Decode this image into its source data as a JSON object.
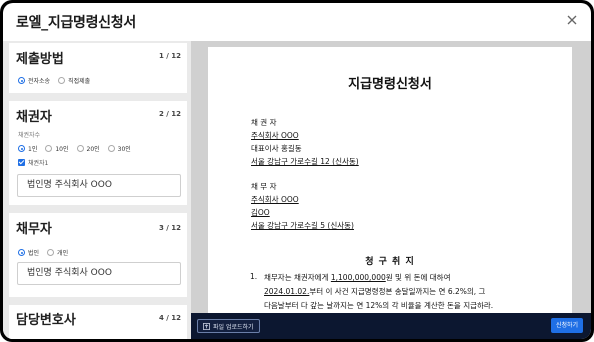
{
  "modal": {
    "title": "로엘_지급명령신청서"
  },
  "sidebar": {
    "card1": {
      "title": "제출방법",
      "step": "1 / 12",
      "options": [
        "전자소송",
        "직접제출"
      ],
      "selected": "전자소송"
    },
    "card2": {
      "title": "채권자",
      "step": "2 / 12",
      "count_caption": "채권자수",
      "count_options": [
        "1인",
        "10인",
        "20인",
        "30인"
      ],
      "count_selected": "1인",
      "checkbox_label": "채권자1",
      "input_value": "법인명 주식회사 OOO"
    },
    "card3": {
      "title": "채무자",
      "step": "3 / 12",
      "options": [
        "법인",
        "개인"
      ],
      "selected": "법인",
      "input_value": "법인명 주식회사 OOO"
    },
    "card4": {
      "title": "담당변호사",
      "step": "4 / 12"
    }
  },
  "document": {
    "title": "지급명령신청서",
    "creditor": {
      "label": "채 권 자",
      "company": "주식회사 OOO",
      "rep": "대표이사 홍길동",
      "address": "서울 강남구 가로수길 12 (신사동)"
    },
    "debtor": {
      "label": "채 무 자",
      "company": "주식회사 OOO",
      "rep": "김OO",
      "address": "서울 강남구 가로수길 5 (신사동)"
    },
    "section_title": "청 구 취 지",
    "claim_number": "1.",
    "claim": {
      "l1_a": "채무자는 채권자에게 ",
      "l1_amount": "1,100,000,000",
      "l1_b": "원 및 위 돈에 대하여",
      "l2_date": "2024.01.02.",
      "l2_b": "부터 이 사건 지급명령정본 송달일까지는 연 6.2%의, 그",
      "l3": "다음날부터 다 갚는 날까지는 연 12%의 각 비율을 계산한 돈을 지급하라."
    }
  },
  "footer": {
    "upload_label": "파일 업로드하기",
    "apply_label": "신청하기"
  },
  "colors": {
    "accent": "#1f6fe5",
    "footer_bg": "#0c1730",
    "sidebar_bg": "#eaeaea",
    "preview_bg": "#d0d0d0"
  }
}
